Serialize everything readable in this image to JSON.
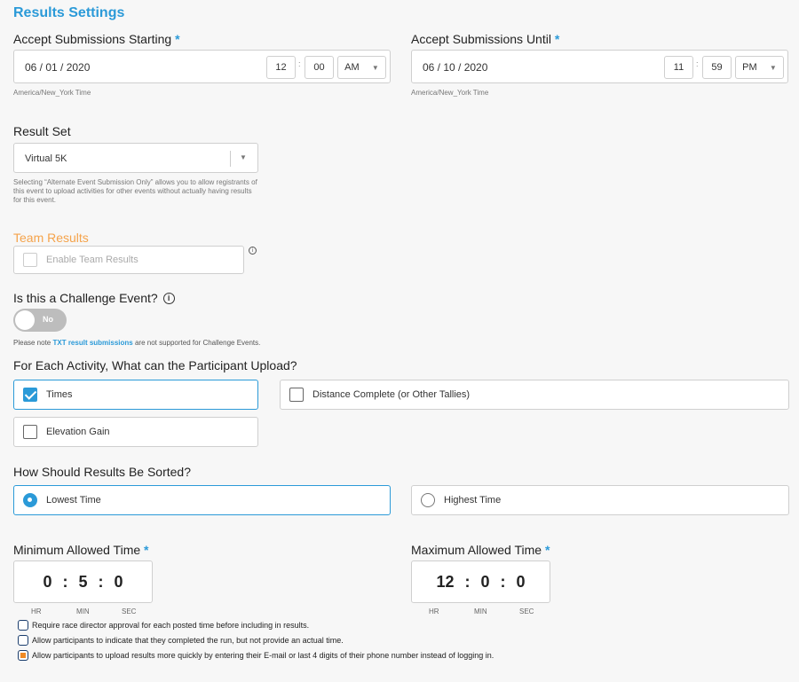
{
  "page": {
    "title": "Results Settings"
  },
  "start": {
    "label": "Accept Submissions Starting",
    "required": "*",
    "date": "06 / 01 / 2020",
    "hour": "12",
    "minute": "00",
    "ampm": "AM",
    "tz": "America/New_York Time",
    "colon": ":"
  },
  "until": {
    "label": "Accept Submissions Until",
    "required": "*",
    "date": "06 / 10 / 2020",
    "hour": "11",
    "minute": "59",
    "ampm": "PM",
    "tz": "America/New_York Time",
    "colon": ":"
  },
  "result_set": {
    "label": "Result Set",
    "value": "Virtual 5K",
    "hint": "Selecting “Alternate Event Submission Only” allows you to allow registrants of this event to upload activities for other events without actually having results for this event."
  },
  "team": {
    "label": "Team Results",
    "checkbox_label": "Enable Team Results",
    "info": "i"
  },
  "challenge": {
    "label": "Is this a Challenge Event?",
    "info": "i",
    "toggle_label": "No",
    "note_prefix": "Please note ",
    "note_link": "TXT result submissions",
    "note_suffix": " are not supported for Challenge Events."
  },
  "upload": {
    "label": "For Each Activity, What can the Participant Upload?",
    "options": [
      {
        "label": "Times",
        "checked": true
      },
      {
        "label": "Distance Complete (or Other Tallies)",
        "checked": false
      },
      {
        "label": "Elevation Gain",
        "checked": false
      }
    ]
  },
  "sort": {
    "label": "How Should Results Be Sorted?",
    "options": [
      {
        "label": "Lowest Time",
        "selected": true
      },
      {
        "label": "Highest Time",
        "selected": false
      }
    ]
  },
  "min_time": {
    "label": "Minimum Allowed Time",
    "required": "*",
    "hr": "0",
    "min": "5",
    "sec": "0",
    "sep": ":",
    "units": {
      "hr": "HR",
      "min": "MIN",
      "sec": "SEC"
    }
  },
  "max_time": {
    "label": "Maximum Allowed Time",
    "required": "*",
    "hr": "12",
    "min": "0",
    "sec": "0",
    "sep": ":",
    "units": {
      "hr": "HR",
      "min": "MIN",
      "sec": "SEC"
    }
  },
  "options_bottom": [
    {
      "label": "Require race director approval for each posted time before including in results.",
      "checked": false
    },
    {
      "label": "Allow participants to indicate that they completed the run, but not provide an actual time.",
      "checked": false
    },
    {
      "label": "Allow participants to upload results more quickly by entering their E-mail or last 4 digits of their phone number instead of logging in.",
      "checked": true
    }
  ],
  "colors": {
    "accent": "#2b9ad8",
    "team_label": "#f5a34b",
    "checkbox_orange": "#f08a24"
  }
}
